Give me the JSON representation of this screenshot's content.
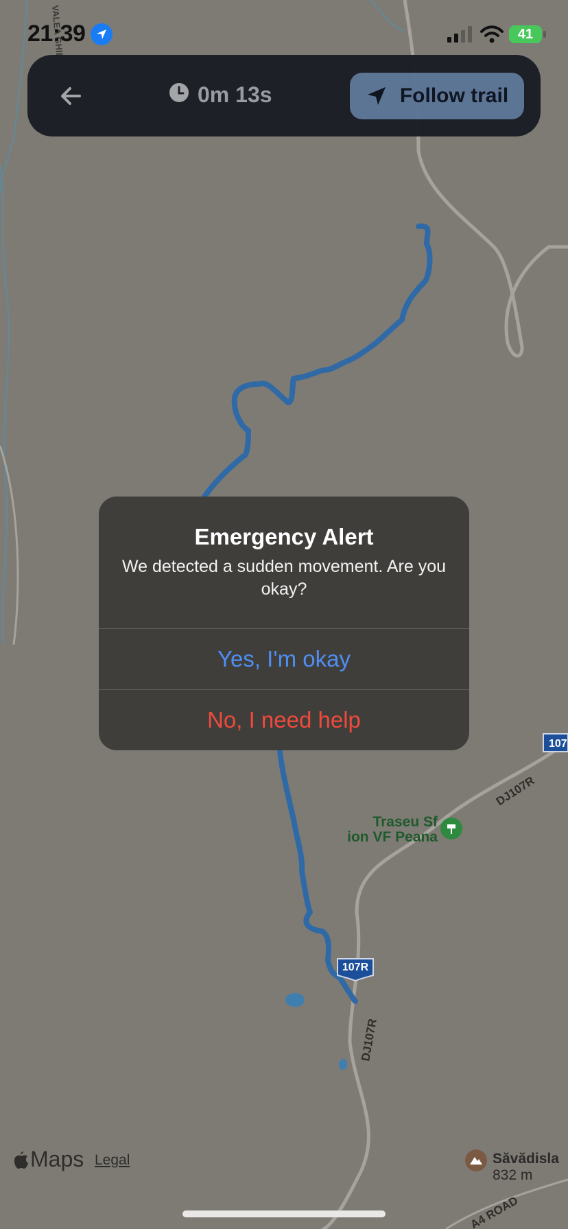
{
  "status_bar": {
    "time": "21:39",
    "battery": "41",
    "icons": [
      "location-arrow-icon",
      "cellular-signal-icon",
      "wifi-icon",
      "battery-charging-icon"
    ]
  },
  "nav": {
    "timer": "0m 13s",
    "follow_label": "Follow trail",
    "icons": [
      "back-arrow-icon",
      "clock-icon",
      "navigation-arrow-icon"
    ]
  },
  "alert": {
    "title": "Emergency Alert",
    "message": "We detected a sudden movement. Are you okay?",
    "ok_label": "Yes, I'm okay",
    "help_label": "No, I need help"
  },
  "map": {
    "poi_label_line1": "Traseu Sf",
    "poi_label_line2": "ion VF Peana",
    "peak_name": "Săvădisla",
    "peak_elevation": "832 m",
    "road_shield": "107R",
    "road_shield_edge": "107",
    "road_label_1": "DJ107R",
    "road_label_2": "DJ107R",
    "road_label_3": "A4 ROAD",
    "edge_label": "VALEA GHIBAD",
    "colors": {
      "trail": "#2f6aa6",
      "poi": "#2e8a3e",
      "shield": "#1b4f9a"
    }
  },
  "footer": {
    "maps_text": "Maps",
    "legal": "Legal"
  }
}
